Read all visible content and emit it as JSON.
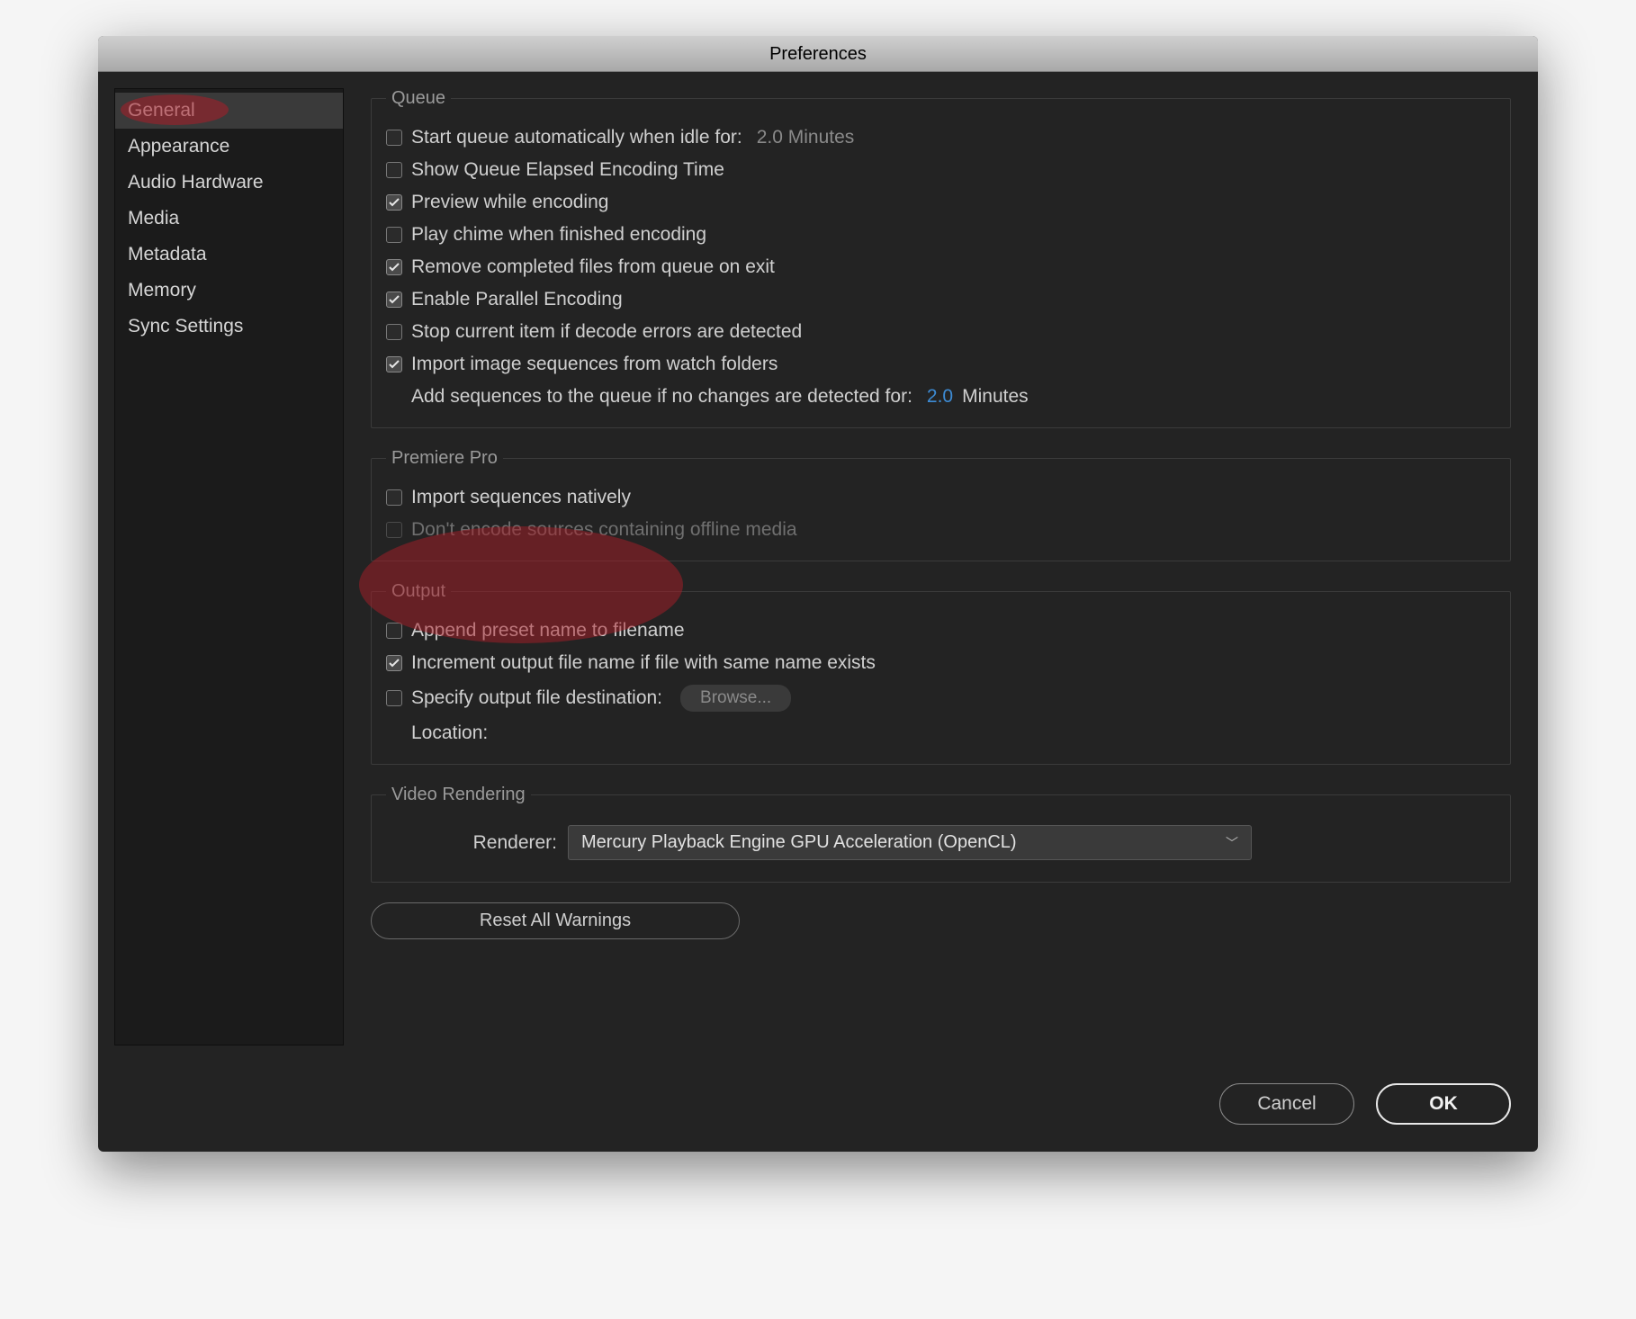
{
  "window": {
    "title": "Preferences"
  },
  "sidebar": {
    "items": [
      {
        "label": "General",
        "selected": true
      },
      {
        "label": "Appearance"
      },
      {
        "label": "Audio Hardware"
      },
      {
        "label": "Media"
      },
      {
        "label": "Metadata"
      },
      {
        "label": "Memory"
      },
      {
        "label": "Sync Settings"
      }
    ]
  },
  "queue": {
    "legend": "Queue",
    "start_auto_label": "Start queue automatically when idle for:",
    "start_auto_value": "2.0 Minutes",
    "show_elapsed_label": "Show Queue Elapsed Encoding Time",
    "preview_label": "Preview while encoding",
    "chime_label": "Play chime when finished encoding",
    "remove_completed_label": "Remove completed files from queue on exit",
    "parallel_label": "Enable Parallel Encoding",
    "stop_decode_label": "Stop current item if decode errors are detected",
    "import_seq_label": "Import image sequences from watch folders",
    "add_seq_label": "Add sequences to the queue if no changes are detected for:",
    "add_seq_value": "2.0",
    "add_seq_unit": "Minutes"
  },
  "premiere": {
    "legend": "Premiere Pro",
    "import_native_label": "Import sequences natively",
    "dont_encode_label": "Don't encode sources containing offline media"
  },
  "output": {
    "legend": "Output",
    "append_label": "Append preset name to filename",
    "increment_label": "Increment output file name if file with same name exists",
    "specify_label": "Specify output file destination:",
    "browse_label": "Browse...",
    "location_label": "Location:"
  },
  "video": {
    "legend": "Video Rendering",
    "renderer_label": "Renderer:",
    "renderer_value": "Mercury Playback Engine GPU Acceleration (OpenCL)"
  },
  "buttons": {
    "reset": "Reset All Warnings",
    "cancel": "Cancel",
    "ok": "OK"
  }
}
